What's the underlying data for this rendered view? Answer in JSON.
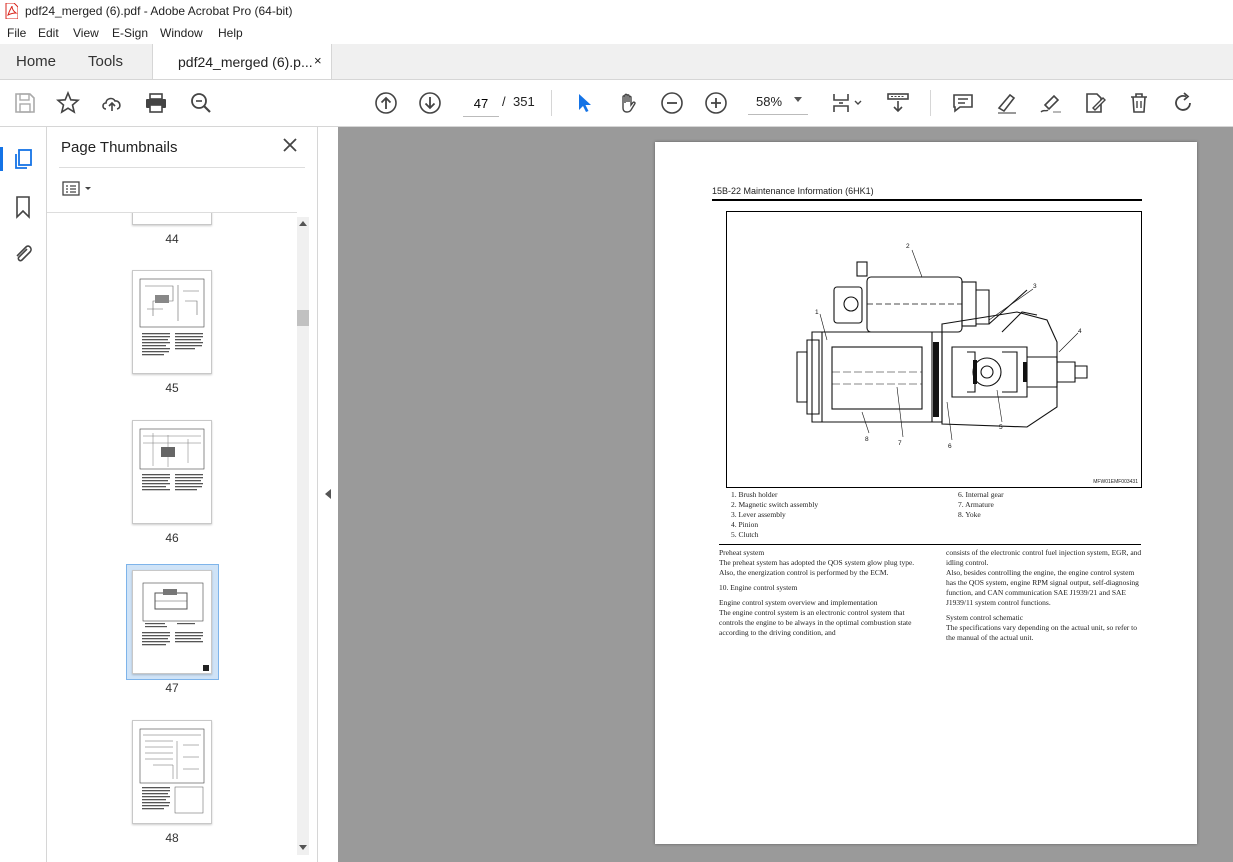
{
  "window": {
    "title": "pdf24_merged (6).pdf - Adobe Acrobat Pro (64-bit)"
  },
  "menu": [
    "File",
    "Edit",
    "View",
    "E-Sign",
    "Window",
    "Help"
  ],
  "tabs": {
    "home": "Home",
    "tools": "Tools",
    "document": "pdf24_merged (6).p...",
    "close": "×"
  },
  "toolbar": {
    "current_page": "47",
    "separator": "/",
    "total_pages": "351",
    "zoom": "58%"
  },
  "panel": {
    "title": "Page Thumbnails"
  },
  "thumbnails": [
    {
      "page": "44"
    },
    {
      "page": "45"
    },
    {
      "page": "46"
    },
    {
      "page": "47",
      "selected": true
    },
    {
      "page": "48"
    }
  ],
  "page": {
    "header": "15B-22  Maintenance Information (6HK1)",
    "figure_code": "MFW01EMF003431",
    "callouts": [
      "1",
      "2",
      "3",
      "4",
      "5",
      "6",
      "7",
      "8"
    ],
    "legend_left": [
      "1.   Brush holder",
      "2.   Magnetic switch assembly",
      "3.   Lever assembly",
      "4.   Pinion",
      "5.   Clutch"
    ],
    "legend_right": [
      "6.   Internal gear",
      "7.   Armature",
      "8.   Yoke"
    ],
    "left_col": {
      "p1": "Preheat system",
      "p2": "The preheat system has adopted the QOS system glow plug type. Also, the energization control is performed by the ECM.",
      "p3": "10.   Engine control system",
      "p4": "Engine control system overview and implementation",
      "p5": "The engine control system is an electronic control system that controls the engine to be always in the optimal combustion state according to the driving condition, and"
    },
    "right_col": {
      "p1": "consists of the electronic control fuel injection system, EGR, and idling control.",
      "p2": "Also, besides controlling the engine, the engine control system has the QOS system, engine RPM signal output, self-diagnosing function, and CAN communication SAE J1939/21 and SAE J1939/11 system control functions.",
      "p3": "System control schematic",
      "p4": "The specifications vary depending on the actual unit, so refer to the manual of the actual unit."
    }
  },
  "colors": {
    "accent": "#1473e6",
    "doc_background": "#9a9a9a",
    "pdf_red": "#d9261c"
  }
}
